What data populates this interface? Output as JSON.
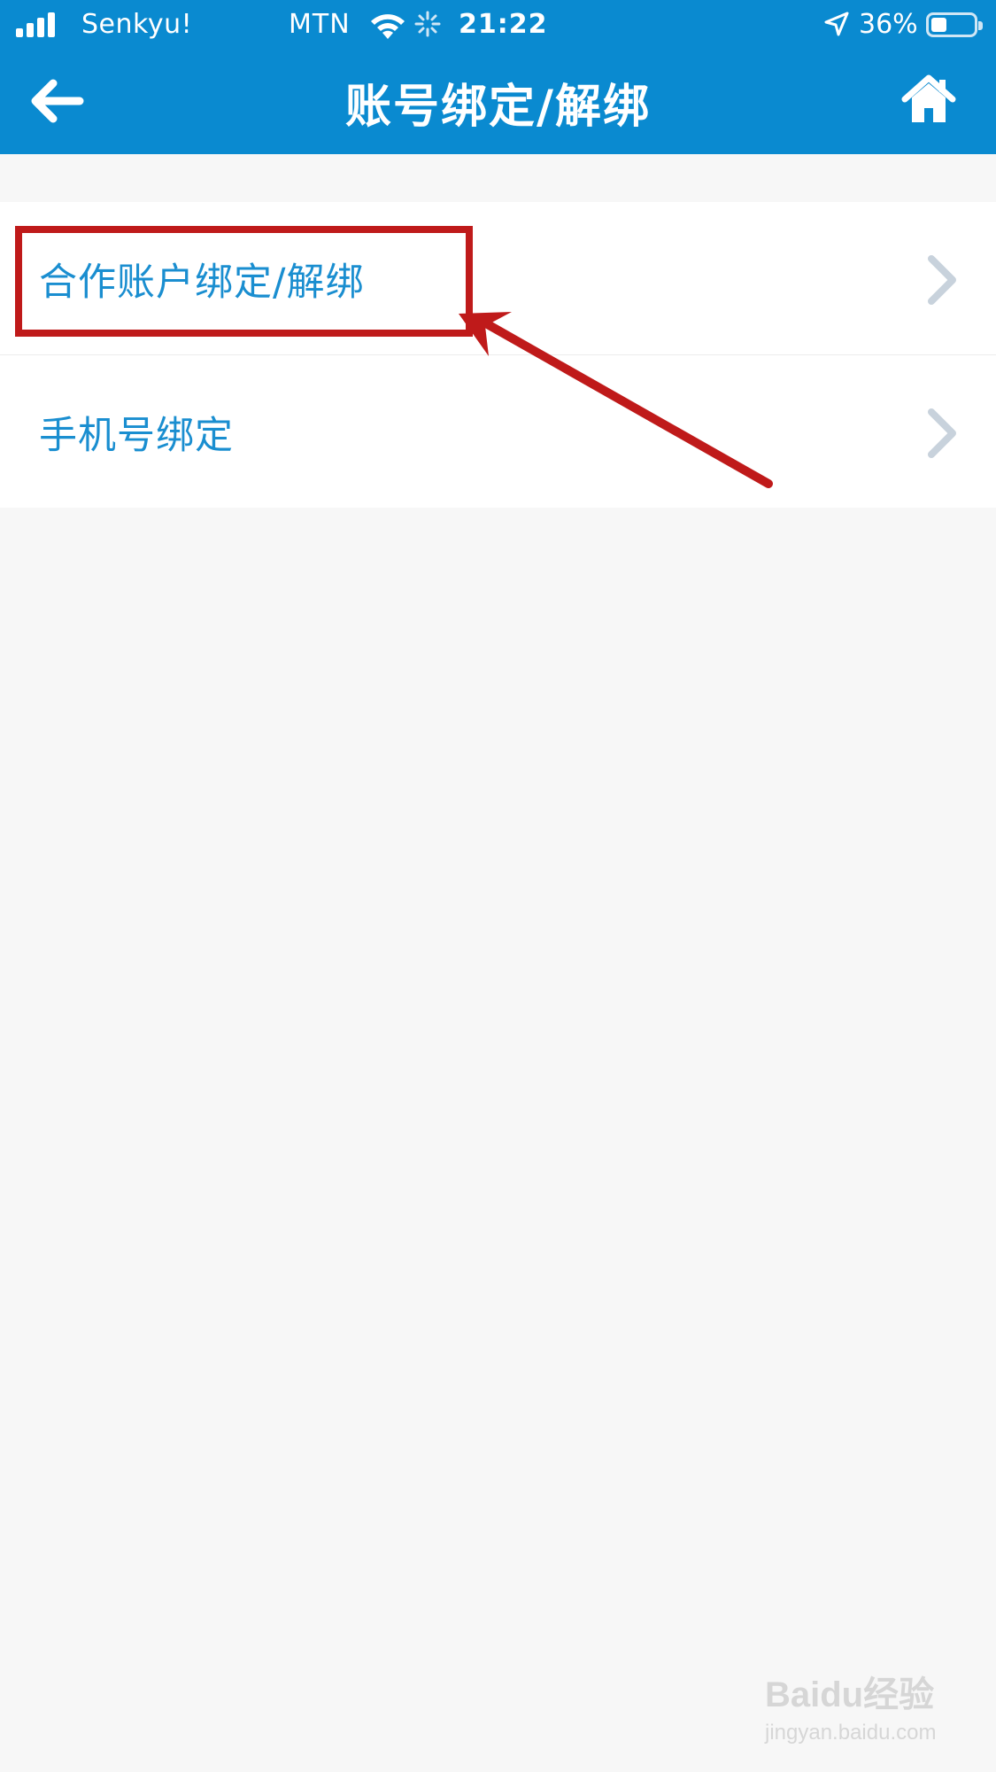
{
  "status_bar": {
    "carrier": "Senkyu!",
    "carrier2": "MTN",
    "time": "21:22",
    "battery_percent": "36%",
    "battery_level": 0.36
  },
  "nav": {
    "title": "账号绑定/解绑",
    "back_icon": "back-arrow-icon",
    "home_icon": "home-icon"
  },
  "menu": {
    "items": [
      {
        "label": "合作账户绑定/解绑",
        "icon": "chevron-right-icon"
      },
      {
        "label": "手机号绑定",
        "icon": "chevron-right-icon"
      }
    ]
  },
  "colors": {
    "header": "#0a8ad0",
    "label": "#1a8ed0",
    "annotation": "#bf1a1a",
    "chevron": "#c8d2dc"
  },
  "watermark": {
    "brand": "Baidu经验",
    "site": "jingyan.baidu.com"
  }
}
